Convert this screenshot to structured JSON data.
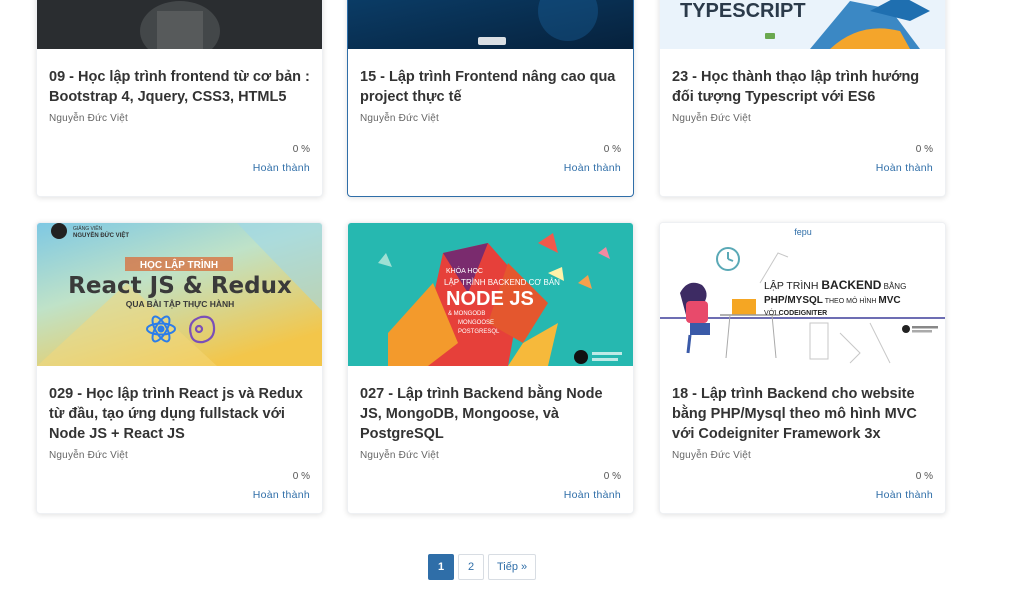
{
  "courses": [
    {
      "title": "09 - Học lập trình frontend từ cơ bản : Bootstrap 4, Jquery, CSS3, HTML5",
      "author": "Nguyễn Đức Việt",
      "progress": "0 %",
      "status": "Hoàn thành"
    },
    {
      "title": "15 - Lập trình Frontend nâng cao qua project thực tế",
      "author": "Nguyễn Đức Việt",
      "progress": "0 %",
      "status": "Hoàn thành"
    },
    {
      "title": "23 - Học thành thạo lập trình hướng đối tượng Typescript với ES6",
      "author": "Nguyễn Đức Việt",
      "progress": "0 %",
      "status": "Hoàn thành",
      "thumb_text": "TYPESCRIPT"
    },
    {
      "title": "029 - Học lập trình React js và Redux từ đầu, tạo ứng dụng fullstack với Node JS + React JS",
      "author": "Nguyễn Đức Việt",
      "progress": "0 %",
      "status": "Hoàn thành",
      "thumb_top": "HỌC LẬP TRÌNH",
      "thumb_main": "React JS & Redux",
      "thumb_sub": "QUA BÀI TẬP THỰC HÀNH",
      "thumb_brand": "NGUYỄN ĐỨC VIỆT"
    },
    {
      "title": "027 - Lập trình Backend bằng Node JS, MongoDB, Mongoose, và PostgreSQL",
      "author": "Nguyễn Đức Việt",
      "progress": "0 %",
      "status": "Hoàn thành",
      "thumb_top": "KHÓA HỌC",
      "thumb_line": "LẬP TRÌNH BACKEND CƠ BẢN",
      "thumb_main": "NODE JS",
      "thumb_sub1": "& MONGODB",
      "thumb_sub2": "MONGOOSE",
      "thumb_sub3": "POSTGRESQL"
    },
    {
      "title": "18 - Lập trình Backend cho website bằng PHP/Mysql theo mô hình MVC với Codeigniter Framework 3x",
      "author": "Nguyễn Đức Việt",
      "progress": "0 %",
      "status": "Hoàn thành",
      "thumb_brand": "fepu",
      "thumb_l1a": "LẬP TRÌNH ",
      "thumb_l1b": "BACKEND",
      "thumb_l1c": " BẰNG",
      "thumb_l2a": "PHP/MYSQL",
      "thumb_l2b": " THEO MÔ HÌNH ",
      "thumb_l2c": "MVC",
      "thumb_l3a": "VỚI ",
      "thumb_l3b": "CODEIGNITER"
    }
  ],
  "pagination": {
    "page1": "1",
    "page2": "2",
    "next": "Tiếp »"
  },
  "colors": {
    "accent": "#2f6ea8"
  }
}
